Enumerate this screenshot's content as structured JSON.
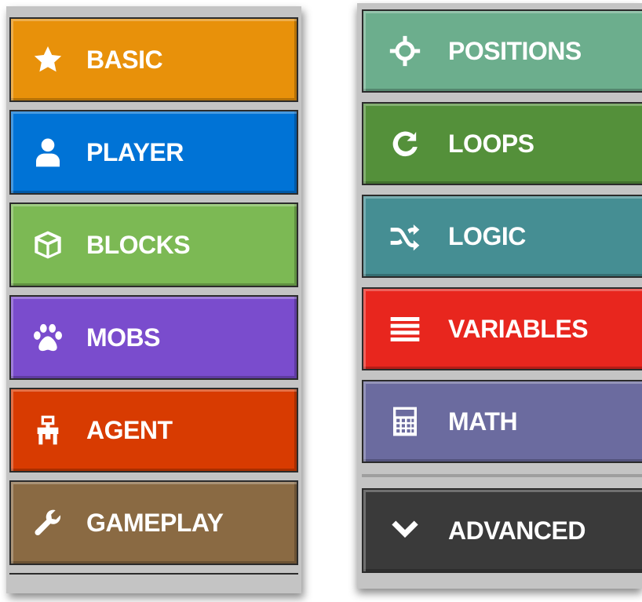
{
  "left_panel": {
    "items": [
      {
        "label": "BASIC",
        "icon": "star-icon",
        "color": "#e8910a"
      },
      {
        "label": "PLAYER",
        "icon": "person-icon",
        "color": "#0073d6"
      },
      {
        "label": "BLOCKS",
        "icon": "cube-icon",
        "color": "#7cb954"
      },
      {
        "label": "MOBS",
        "icon": "paw-icon",
        "color": "#7a4ccd"
      },
      {
        "label": "AGENT",
        "icon": "robot-icon",
        "color": "#d83b01"
      },
      {
        "label": "GAMEPLAY",
        "icon": "wrench-icon",
        "color": "#8a6a43"
      }
    ]
  },
  "right_panel": {
    "items": [
      {
        "label": "POSITIONS",
        "icon": "crosshair-icon",
        "color": "#6cae8d"
      },
      {
        "label": "LOOPS",
        "icon": "refresh-icon",
        "color": "#54903a"
      },
      {
        "label": "LOGIC",
        "icon": "shuffle-icon",
        "color": "#458e93"
      },
      {
        "label": "VARIABLES",
        "icon": "list-icon",
        "color": "#e8261e"
      },
      {
        "label": "MATH",
        "icon": "calculator-icon",
        "color": "#6b6b9f"
      },
      {
        "label": "ADVANCED",
        "icon": "chevron-down-icon",
        "color": "#3a3a3a"
      }
    ]
  }
}
